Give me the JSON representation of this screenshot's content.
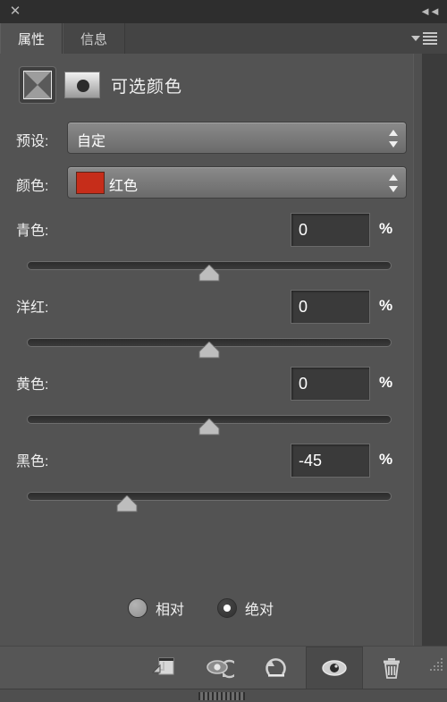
{
  "titlebar": {
    "close_label": "✕",
    "collapse_label": "◄◄"
  },
  "tabs": [
    {
      "label": "属性",
      "active": true
    },
    {
      "label": "信息",
      "active": false
    }
  ],
  "panel_menu": {
    "name": "panel-menu-icon"
  },
  "adjustment": {
    "icon_name": "selective-color-icon",
    "mask_name": "layer-mask-thumbnail",
    "title": "可选颜色"
  },
  "dropdowns": [
    {
      "label": "预设:",
      "value": "自定",
      "swatch": null
    },
    {
      "label": "颜色:",
      "value": "红色",
      "swatch": "#c62d1a"
    }
  ],
  "sliders": [
    {
      "label": "青色:",
      "value": "0",
      "percent": "%",
      "pos": 50.0
    },
    {
      "label": "洋红:",
      "value": "0",
      "percent": "%",
      "pos": 50.0
    },
    {
      "label": "黄色:",
      "value": "0",
      "percent": "%",
      "pos": 50.0
    },
    {
      "label": "黑色:",
      "value": "-45",
      "percent": "%",
      "pos": 27.5
    }
  ],
  "method": {
    "relative": {
      "label": "相对",
      "selected": false
    },
    "absolute": {
      "label": "绝对",
      "selected": true
    }
  },
  "toolbar": [
    {
      "name": "clip-to-layer-icon",
      "active": false
    },
    {
      "name": "view-previous-state-icon",
      "active": false
    },
    {
      "name": "reset-icon",
      "active": false
    },
    {
      "name": "toggle-visibility-icon",
      "active": true
    },
    {
      "name": "delete-adjustment-icon",
      "active": false
    }
  ],
  "colors": {
    "panel_bg": "#535353",
    "tabbar_bg": "#444444",
    "titlebar_bg": "#2e2e2e",
    "toolbar_bg": "#565656",
    "text": "#f0f0f0",
    "swatch_red": "#c62d1a",
    "field_bg": "#3a3a3a"
  }
}
